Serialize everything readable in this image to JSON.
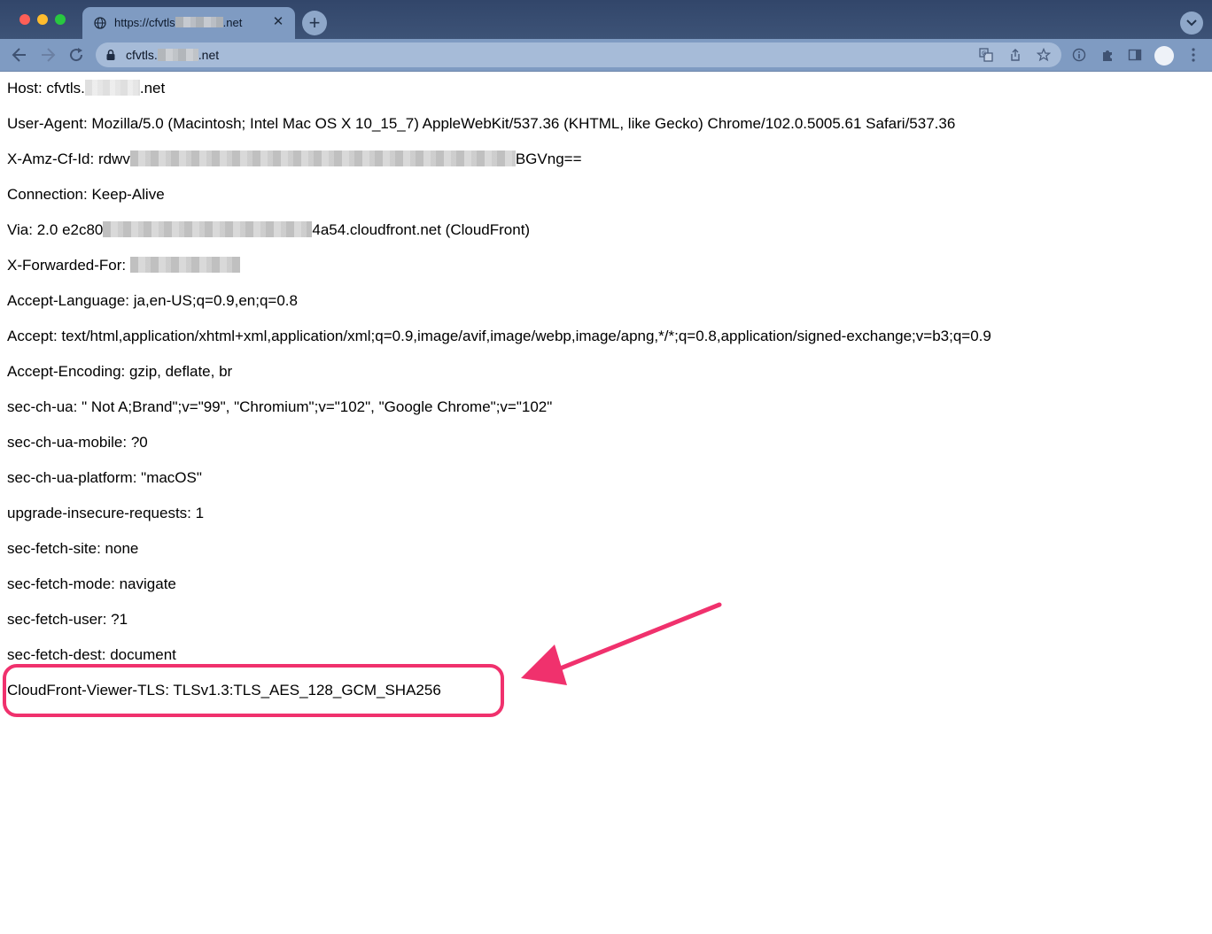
{
  "browser": {
    "tab_title_prefix": "https://cfvtls",
    "tab_title_suffix": ".net",
    "url_prefix": "cfvtls.",
    "url_suffix": ".net",
    "icons": [
      "globe-icon",
      "close-icon",
      "plus-icon",
      "chevron-down-icon",
      "back-icon",
      "forward-icon",
      "reload-icon",
      "lock-icon",
      "translate-icon",
      "share-icon",
      "star-icon",
      "info-icon",
      "extensions-icon",
      "side-panel-icon",
      "avatar",
      "more-icon"
    ]
  },
  "headers": {
    "host_prefix": "Host: cfvtls.",
    "host_suffix": ".net",
    "user_agent": "User-Agent: Mozilla/5.0 (Macintosh; Intel Mac OS X 10_15_7) AppleWebKit/537.36 (KHTML, like Gecko) Chrome/102.0.5005.61 Safari/537.36",
    "amz_id_prefix": "X-Amz-Cf-Id: rdwv",
    "amz_id_suffix": "BGVng==",
    "connection": "Connection: Keep-Alive",
    "via_prefix": "Via: 2.0 e2c80",
    "via_suffix": "4a54.cloudfront.net (CloudFront)",
    "forwarded_prefix": "X-Forwarded-For: ",
    "accept_language": "Accept-Language: ja,en-US;q=0.9,en;q=0.8",
    "accept": "Accept: text/html,application/xhtml+xml,application/xml;q=0.9,image/avif,image/webp,image/apng,*/*;q=0.8,application/signed-exchange;v=b3;q=0.9",
    "accept_encoding": "Accept-Encoding: gzip, deflate, br",
    "sec_ch_ua": "sec-ch-ua: \" Not A;Brand\";v=\"99\", \"Chromium\";v=\"102\", \"Google Chrome\";v=\"102\"",
    "sec_ch_ua_mobile": "sec-ch-ua-mobile: ?0",
    "sec_ch_ua_platform": "sec-ch-ua-platform: \"macOS\"",
    "upgrade_insecure": "upgrade-insecure-requests: 1",
    "sec_fetch_site": "sec-fetch-site: none",
    "sec_fetch_mode": "sec-fetch-mode: navigate",
    "sec_fetch_user": "sec-fetch-user: ?1",
    "sec_fetch_dest": "sec-fetch-dest: document",
    "viewer_tls": "CloudFront-Viewer-TLS: TLSv1.3:TLS_AES_128_GCM_SHA256"
  },
  "annotation": {
    "color": "#f0316d"
  }
}
